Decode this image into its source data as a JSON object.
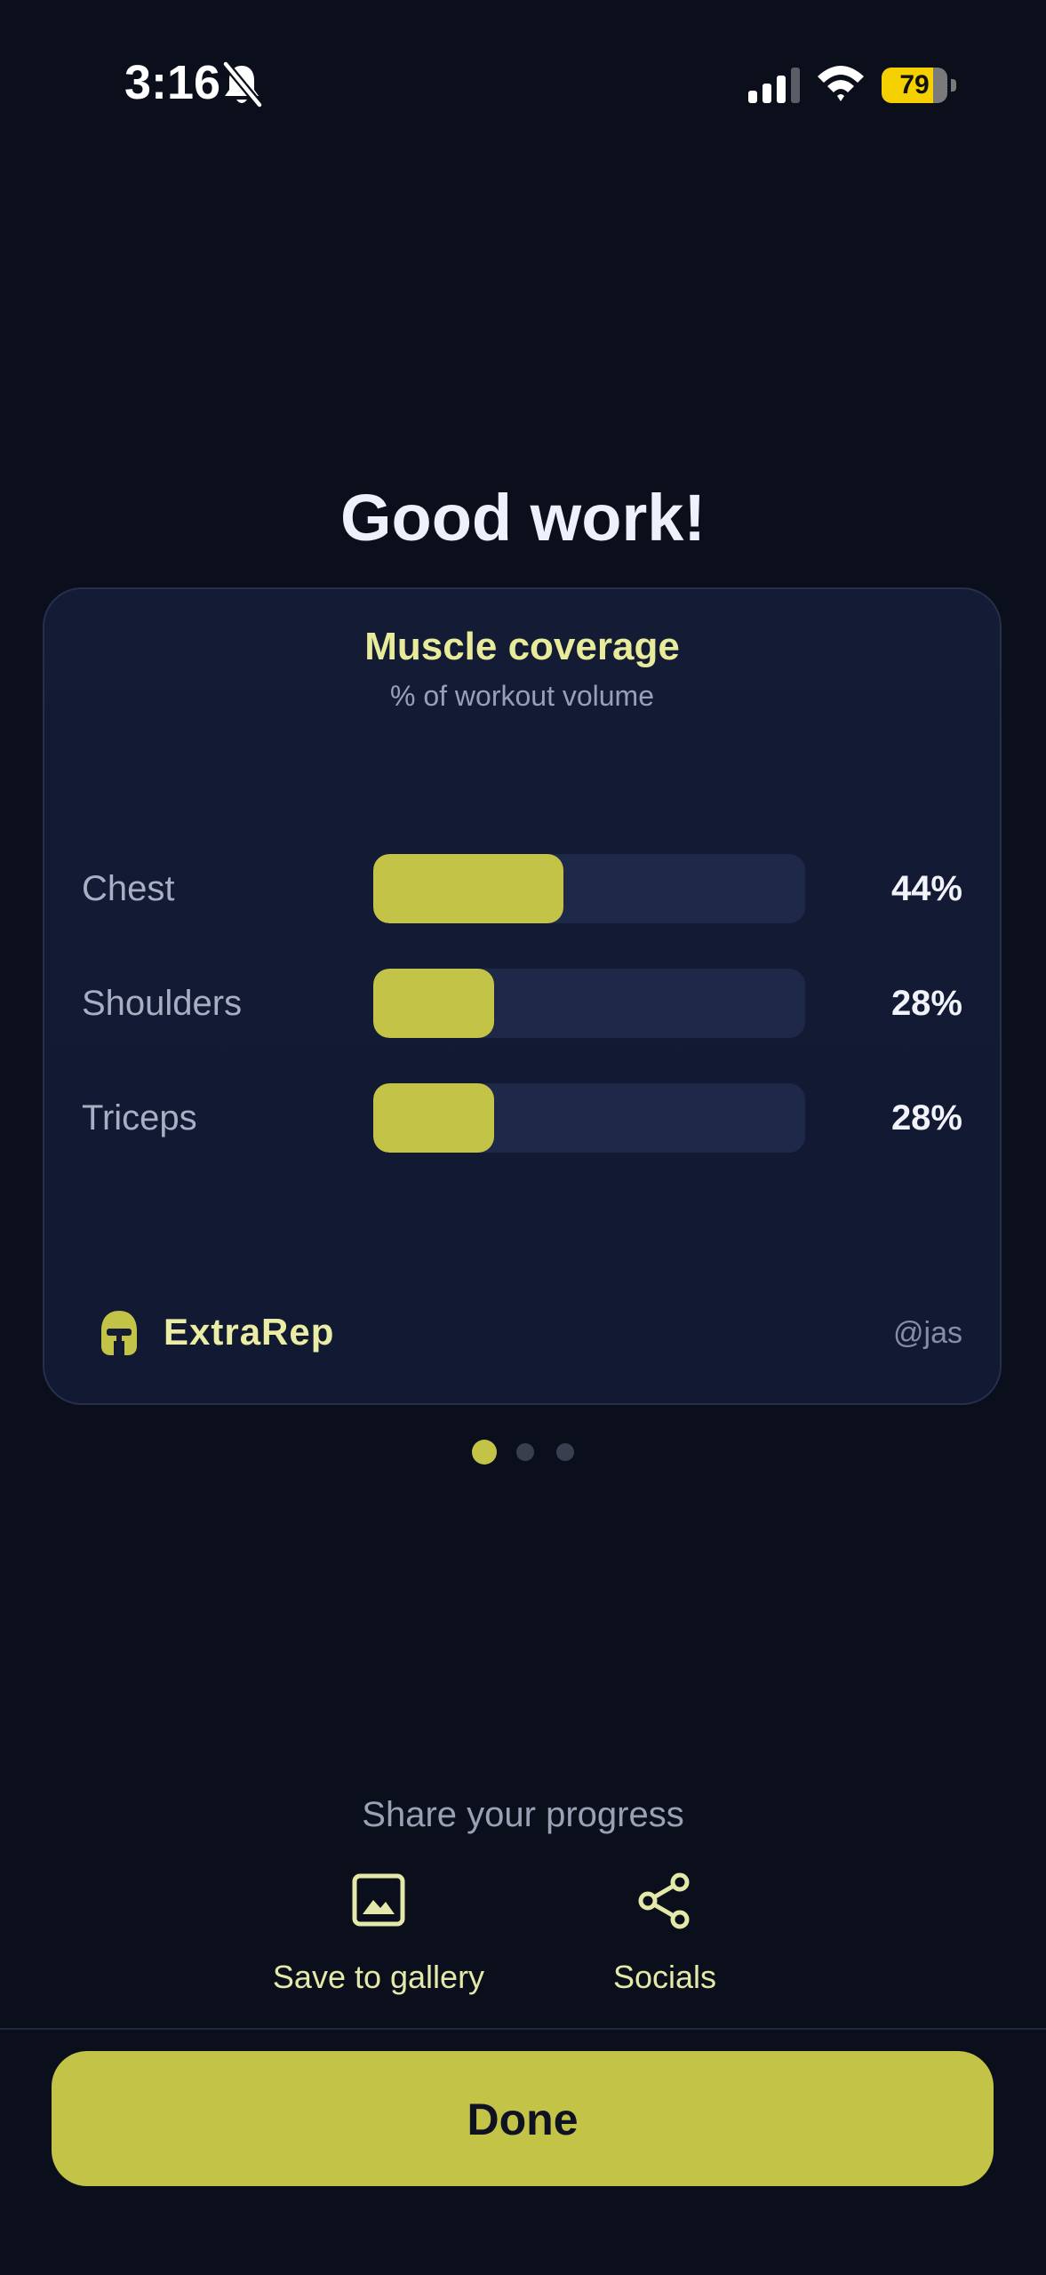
{
  "status_bar": {
    "time": "3:16",
    "battery_level": "79",
    "battery_fraction": 0.79,
    "icons": [
      "bell-slash-icon",
      "signal-icon",
      "wifi-icon",
      "battery-icon"
    ]
  },
  "heading": "Good work!",
  "card": {
    "title": "Muscle coverage",
    "subtitle": "% of workout volume",
    "muscles": [
      {
        "name": "Chest",
        "percent_label": "44%",
        "fraction": 0.44
      },
      {
        "name": "Shoulders",
        "percent_label": "28%",
        "fraction": 0.28
      },
      {
        "name": "Triceps",
        "percent_label": "28%",
        "fraction": 0.28
      }
    ],
    "brand": "ExtraRep",
    "handle": "@jas"
  },
  "pager": {
    "pages": 3,
    "active": 0
  },
  "share": {
    "title": "Share your progress",
    "options": [
      {
        "label": "Save to gallery",
        "icon": "image-icon"
      },
      {
        "label": "Socials",
        "icon": "share-icon"
      }
    ]
  },
  "done_label": "Done",
  "colors": {
    "background": "#0b0f1c",
    "accent": "#c3c347",
    "card": "#131b35",
    "track": "#1e2848",
    "title_accent": "#e8eb9a"
  }
}
